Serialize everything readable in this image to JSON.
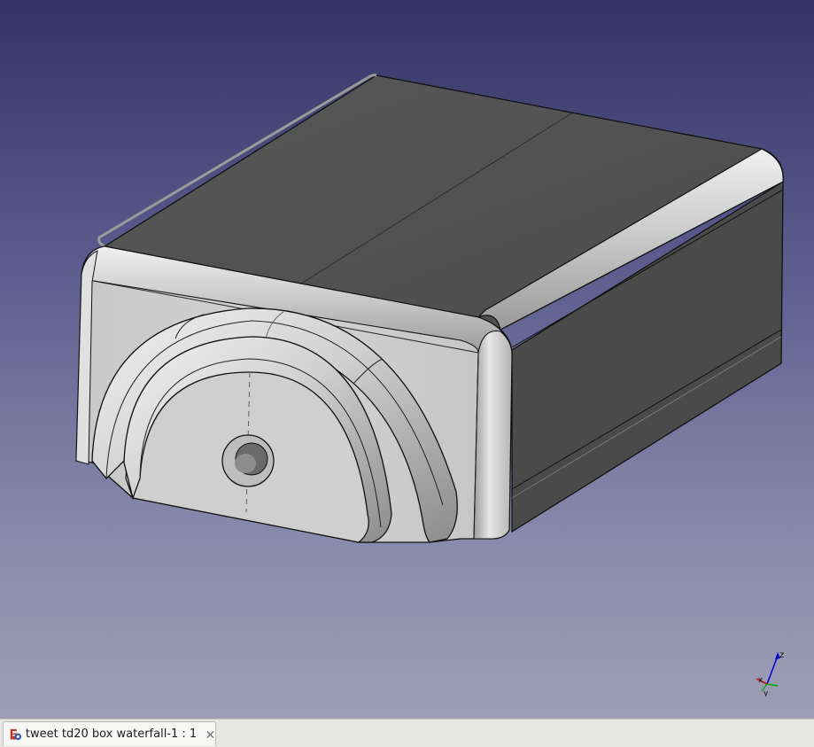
{
  "window": {
    "app": "FreeCAD",
    "view_style": "isometric-3d-viewport"
  },
  "colors": {
    "background_top": "#333366",
    "background_bottom": "#9e9eb6",
    "model_top_face": "#505050",
    "model_side_face": "#4a4a4a",
    "model_front_face": "#cdcdcd",
    "edge": "#000000",
    "axis_x": "#cc0000",
    "axis_y": "#00aa00",
    "axis_z": "#0000cc"
  },
  "axis_indicator": {
    "x_label": "x",
    "y_label": "y",
    "z_label": "z"
  },
  "tabs": [
    {
      "label": "tweet td20 box waterfall-1 : 1",
      "icon": "freecad-document-icon",
      "active": true
    }
  ]
}
